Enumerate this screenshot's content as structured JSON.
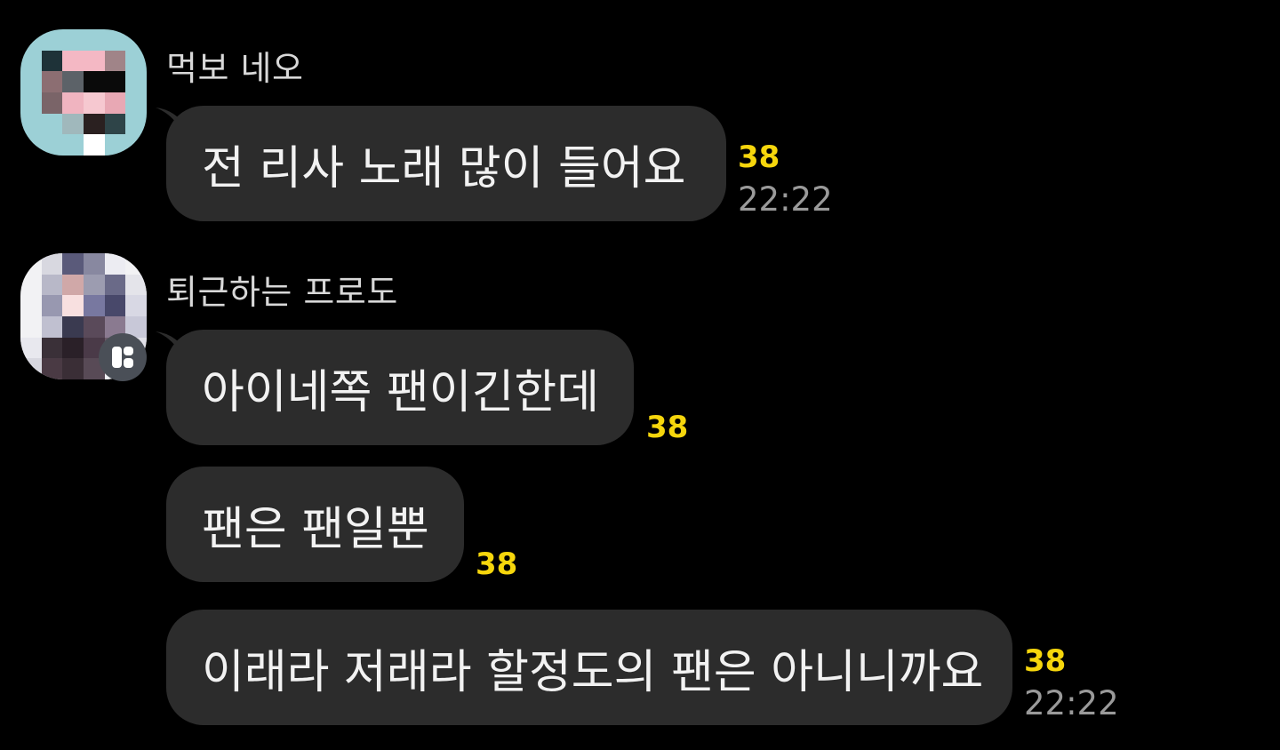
{
  "messages": [
    {
      "sender": "먹보 네오",
      "text": "전 리사 노래 많이 들어요",
      "unread": "38",
      "time": "22:22"
    },
    {
      "sender": "퇴근하는 프로도",
      "text": "아이네쪽 팬이긴한데",
      "unread": "38"
    },
    {
      "text": "팬은 팬일뿐",
      "unread": "38"
    },
    {
      "text": "이래라 저래라 할정도의 팬은 아니니까요",
      "unread": "38",
      "time": "22:22"
    }
  ],
  "colors": {
    "background": "#000000",
    "bubble": "#2c2c2c",
    "unread": "#f6d60c",
    "time": "#9a9a9a"
  },
  "icons": {
    "profile_badge": "openchat-profile-icon"
  }
}
